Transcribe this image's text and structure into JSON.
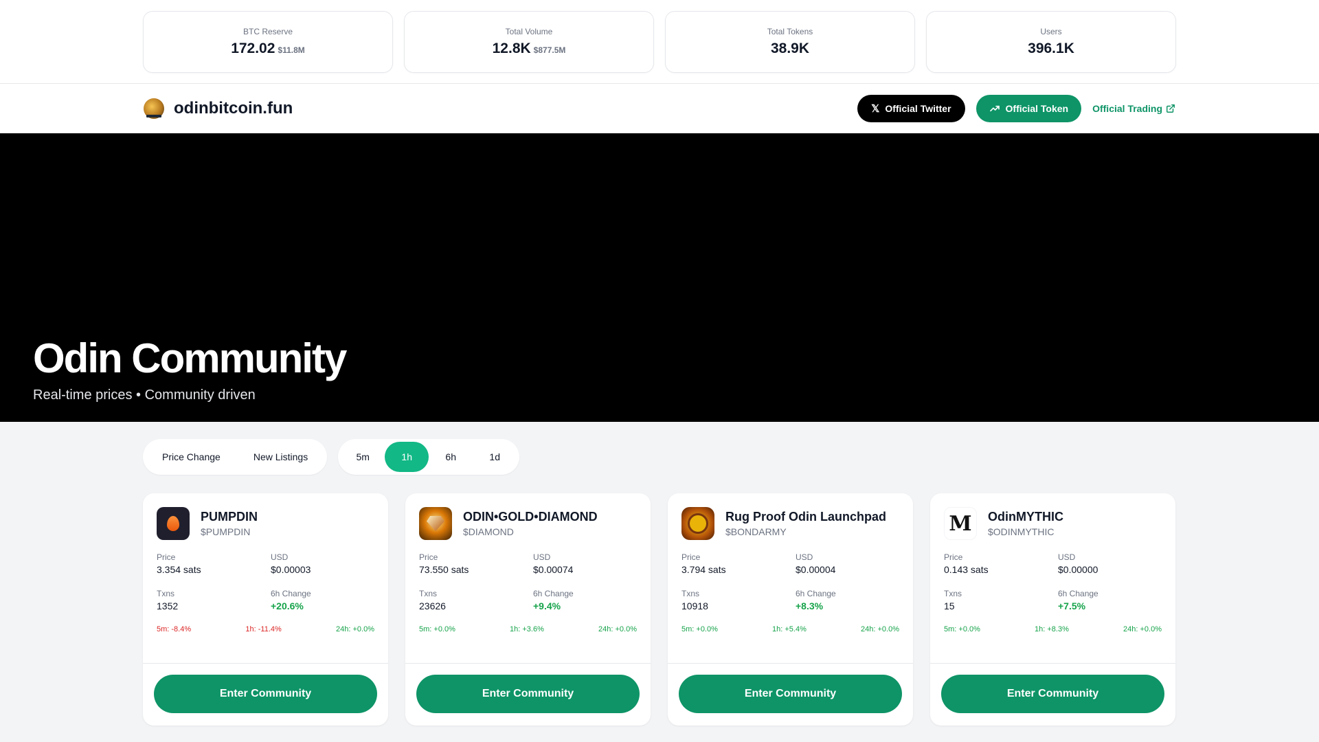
{
  "stats": [
    {
      "label": "BTC Reserve",
      "value": "172.02",
      "sub": "$11.8M"
    },
    {
      "label": "Total Volume",
      "value": "12.8K",
      "sub": "$877.5M"
    },
    {
      "label": "Total Tokens",
      "value": "38.9K",
      "sub": ""
    },
    {
      "label": "Users",
      "value": "396.1K",
      "sub": ""
    }
  ],
  "header": {
    "brand": "odinbitcoin.fun",
    "twitter_label": "Official Twitter",
    "token_label": "Official Token",
    "trading_label": "Official Trading"
  },
  "hero": {
    "title": "Odin Community",
    "subtitle": "Real-time prices • Community driven"
  },
  "filters": {
    "sort": [
      "Price Change",
      "New Listings"
    ],
    "timeframes": [
      "5m",
      "1h",
      "6h",
      "1d"
    ],
    "active_timeframe": "1h"
  },
  "cards": [
    {
      "name": "PUMPDIN",
      "ticker": "$PUMPDIN",
      "icon": "pumpdin-logo",
      "price_label": "Price",
      "price": "3.354 sats",
      "usd_label": "USD",
      "usd": "$0.00003",
      "txns_label": "Txns",
      "txns": "1352",
      "change_label": "6h Change",
      "change": "+20.6%",
      "d5m": "5m: -8.4%",
      "d1h": "1h: -11.4%",
      "d24h": "24h: +0.0%",
      "cta": "Enter Community"
    },
    {
      "name": "ODIN•GOLD•DIAMOND",
      "ticker": "$DIAMOND",
      "icon": "diamond-logo",
      "price_label": "Price",
      "price": "73.550 sats",
      "usd_label": "USD",
      "usd": "$0.00074",
      "txns_label": "Txns",
      "txns": "23626",
      "change_label": "6h Change",
      "change": "+9.4%",
      "d5m": "5m: +0.0%",
      "d1h": "1h: +3.6%",
      "d24h": "24h: +0.0%",
      "cta": "Enter Community"
    },
    {
      "name": "Rug Proof Odin Launchpad",
      "ticker": "$BONDARMY",
      "icon": "bondarmy-logo",
      "price_label": "Price",
      "price": "3.794 sats",
      "usd_label": "USD",
      "usd": "$0.00004",
      "txns_label": "Txns",
      "txns": "10918",
      "change_label": "6h Change",
      "change": "+8.3%",
      "d5m": "5m: +0.0%",
      "d1h": "1h: +5.4%",
      "d24h": "24h: +0.0%",
      "cta": "Enter Community"
    },
    {
      "name": "OdinMYTHIC",
      "ticker": "$ODINMYTHIC",
      "icon": "mythic-logo",
      "price_label": "Price",
      "price": "0.143 sats",
      "usd_label": "USD",
      "usd": "$0.00000",
      "txns_label": "Txns",
      "txns": "15",
      "change_label": "6h Change",
      "change": "+7.5%",
      "d5m": "5m: +0.0%",
      "d1h": "1h: +8.3%",
      "d24h": "24h: +0.0%",
      "cta": "Enter Community"
    }
  ],
  "colors": {
    "accent": "#0e9467",
    "active_tab": "#12b886",
    "positive": "#16a34a",
    "negative": "#dc2626",
    "hero_bg": "#000000"
  }
}
